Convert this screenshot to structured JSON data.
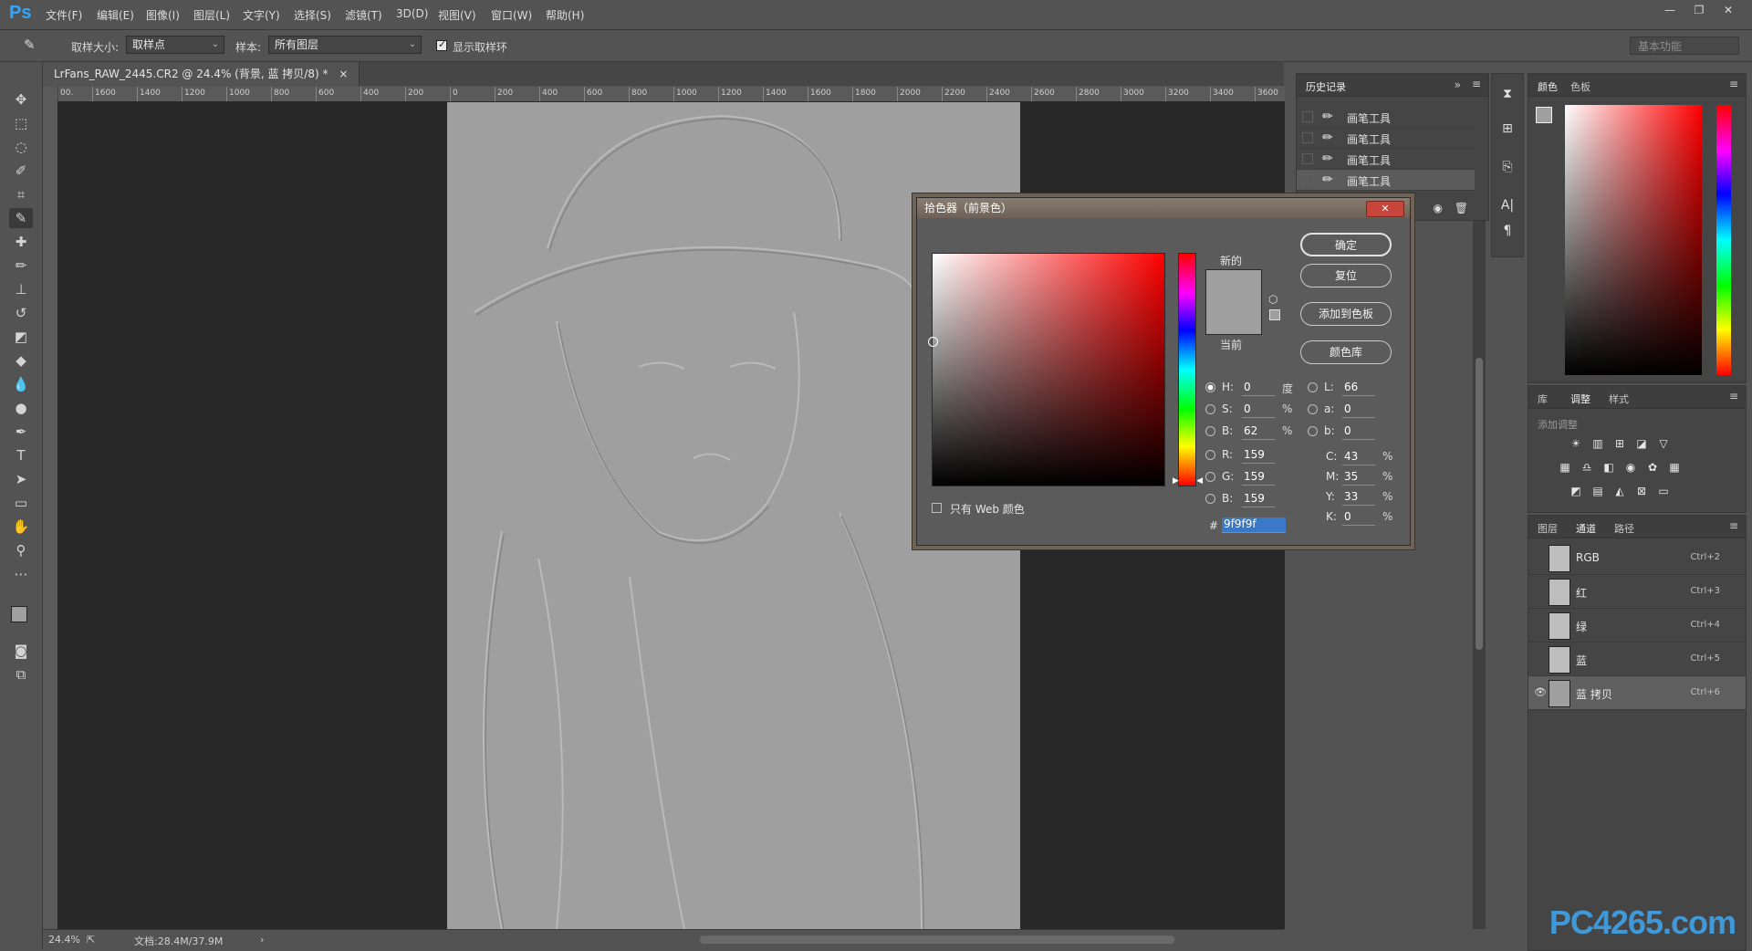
{
  "app": {
    "logo": "Ps",
    "menus": [
      "文件(F)",
      "编辑(E)",
      "图像(I)",
      "图层(L)",
      "文字(Y)",
      "选择(S)",
      "滤镜(T)",
      "3D(D)",
      "视图(V)",
      "窗口(W)",
      "帮助(H)"
    ],
    "window_controls": [
      "—",
      "❐",
      "✕"
    ]
  },
  "options_bar": {
    "sample_size_label": "取样大小:",
    "sample_size_value": "取样点",
    "sample_label": "样本:",
    "sample_value": "所有图层",
    "show_ring_label": "显示取样环",
    "show_ring_checked": true,
    "workspace": "基本功能"
  },
  "document": {
    "tab_title": "LrFans_RAW_2445.CR2 @ 24.4% (背景, 蓝 拷贝/8) *",
    "close": "×",
    "zoom": "24.4%",
    "doc_info": "文档:28.4M/37.9M"
  },
  "ruler_labels": [
    "00.",
    "1600",
    "1400",
    "1200",
    "1000",
    "800",
    "600",
    "400",
    "200",
    "0",
    "200",
    "400",
    "600",
    "800",
    "1000",
    "1200",
    "1400",
    "1600",
    "1800",
    "2000",
    "2200",
    "2400",
    "2600",
    "2800",
    "3000",
    "3200",
    "3400",
    "3600"
  ],
  "history": {
    "tab": "历史记录",
    "items": [
      "画笔工具",
      "画笔工具",
      "画笔工具",
      "画笔工具"
    ]
  },
  "color_panel": {
    "tabs": [
      "颜色",
      "色板"
    ]
  },
  "adjust_panel": {
    "tabs": [
      "库",
      "调整",
      "样式"
    ],
    "hint": "添加调整"
  },
  "channels_panel": {
    "tabs": [
      "图层",
      "通道",
      "路径"
    ],
    "channels": [
      {
        "name": "RGB",
        "shortcut": "Ctrl+2"
      },
      {
        "name": "红",
        "shortcut": "Ctrl+3"
      },
      {
        "name": "绿",
        "shortcut": "Ctrl+4"
      },
      {
        "name": "蓝",
        "shortcut": "Ctrl+5"
      },
      {
        "name": "蓝 拷贝",
        "shortcut": "Ctrl+6"
      }
    ]
  },
  "picker": {
    "title": "拾色器（前景色）",
    "new_label": "新的",
    "current_label": "当前",
    "ok": "确定",
    "reset": "复位",
    "add_swatch": "添加到色板",
    "color_lib": "颜色库",
    "web_only": "只有 Web 颜色",
    "H": "0",
    "S": "0",
    "B": "62",
    "R": "159",
    "G": "159",
    "Bl": "159",
    "L": "66",
    "a": "0",
    "b": "0",
    "C": "43",
    "M": "35",
    "Y": "33",
    "K": "0",
    "hex": "9f9f9f",
    "deg": "度",
    "pct": "%",
    "swatch_color": "#9f9f9f"
  },
  "watermark": "PC4265.com"
}
